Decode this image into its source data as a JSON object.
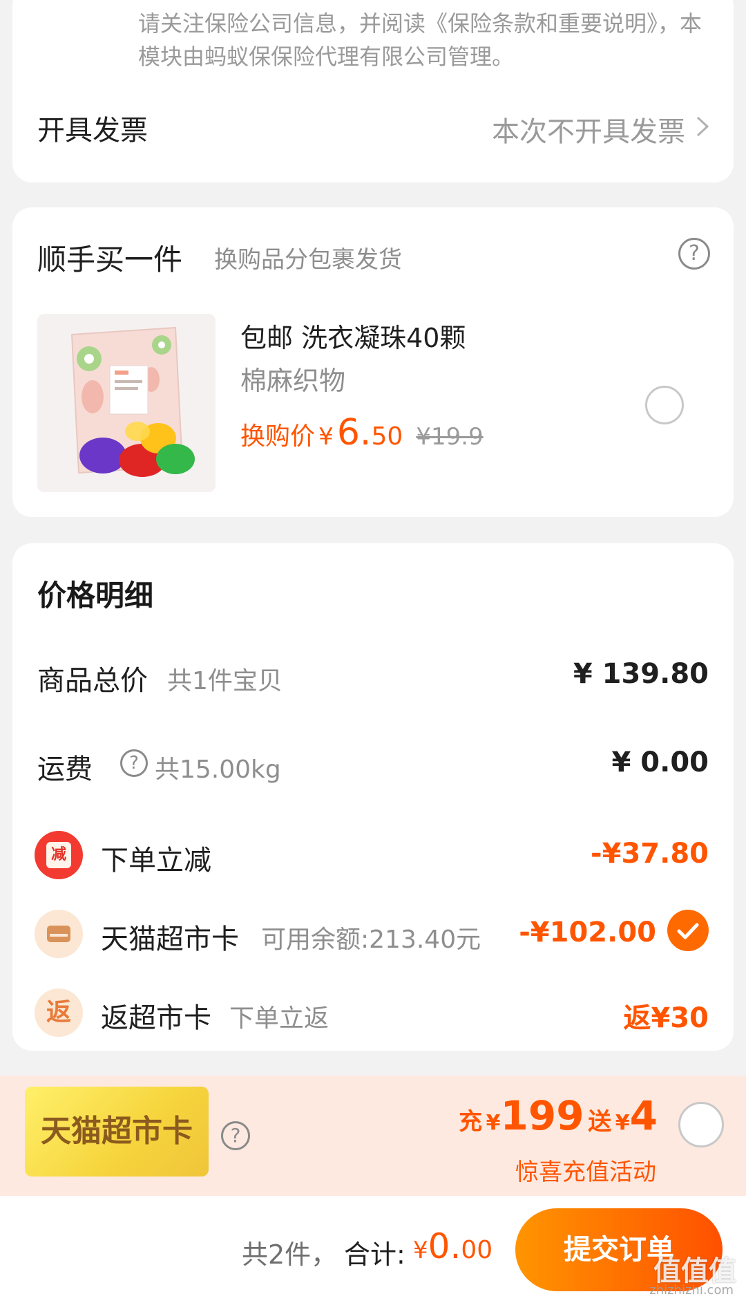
{
  "insurance": {
    "notice": "请关注保险公司信息，并阅读《保险条款和重要说明》，本模块由蚂蚁保保险代理有限公司管理。"
  },
  "invoice": {
    "label": "开具发票",
    "value": "本次不开具发票",
    "icon": "chevron-right-icon"
  },
  "addon": {
    "title": "顺手买一件",
    "subtitle": "换购品分包裹发货",
    "help_symbol": "?",
    "product": {
      "name": "包邮 洗衣凝珠40颗",
      "category": "棉麻织物",
      "price_label": "换购价",
      "price_yen": "¥",
      "price_int": "6.",
      "price_dec": "50",
      "original_price": "¥19.9",
      "selected": false
    }
  },
  "price_detail": {
    "title": "价格明细",
    "goods_total": {
      "label": "商品总价",
      "sub": "共1件宝贝",
      "value": "¥ 139.80"
    },
    "shipping": {
      "label": "运费",
      "help_symbol": "?",
      "sub": "共15.00kg",
      "value": "¥ 0.00"
    },
    "instant_discount": {
      "badge": "减",
      "label": "下单立减",
      "value": "-¥37.80"
    },
    "tmall_card": {
      "label": "天猫超市卡",
      "sub": "可用余额:213.40元",
      "value": "-¥102.00",
      "checked": true
    },
    "return_card": {
      "badge": "返",
      "label": "返超市卡",
      "sub": "下单立返",
      "value": "返¥30"
    }
  },
  "recharge": {
    "card_label": "天猫超市卡",
    "help_symbol": "?",
    "charge_word": "充",
    "charge_yen": "¥",
    "charge_amount": "199",
    "gift_word": "送",
    "gift_yen": "¥",
    "gift_amount": "4",
    "activity": "惊喜充值活动",
    "selected": false
  },
  "bottom_bar": {
    "count": "共2件，",
    "total_label": "合计:",
    "total_yen": "¥",
    "total_int": "0.",
    "total_dec": "00",
    "submit_label": "提交订单",
    "watermark": "值值值",
    "watermark_url": "zhizhizhi.com"
  },
  "colors": {
    "accent": "#ff5500",
    "button_start": "#ff9500",
    "button_end": "#ff5000",
    "background": "#f2f2f2",
    "banner": "#fde9e0"
  }
}
